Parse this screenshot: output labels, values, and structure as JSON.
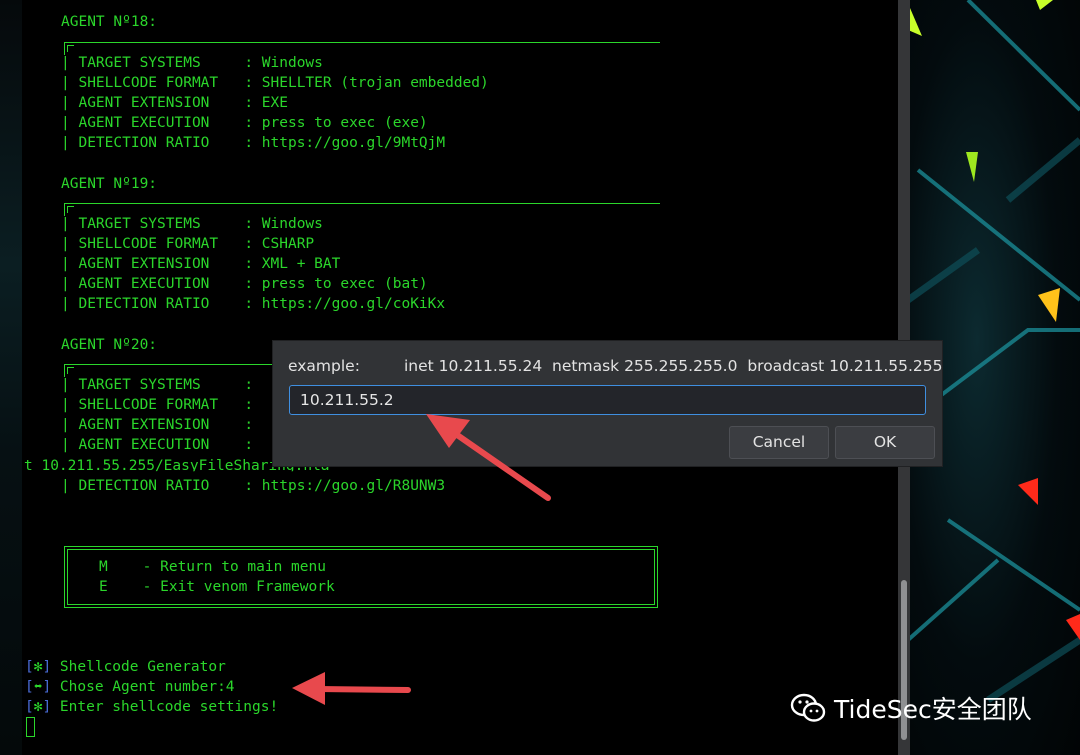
{
  "terminal": {
    "agent18": {
      "header": "AGENT Nº18:",
      "rows": [
        "| TARGET SYSTEMS     : Windows",
        "| SHELLCODE FORMAT   : SHELLTER (trojan embedded)",
        "| AGENT EXTENSION    : EXE",
        "| AGENT EXECUTION    : press to exec (exe)",
        "| DETECTION RATIO    : https://goo.gl/9MtQjM"
      ]
    },
    "agent19": {
      "header": "AGENT Nº19:",
      "rows": [
        "| TARGET SYSTEMS     : Windows",
        "| SHELLCODE FORMAT   : CSHARP",
        "| AGENT EXTENSION    : XML + BAT",
        "| AGENT EXECUTION    : press to exec (bat)",
        "| DETECTION RATIO    : https://goo.gl/coKiKx"
      ]
    },
    "agent20": {
      "header": "AGENT Nº20:",
      "rows": [
        "| TARGET SYSTEMS     :",
        "| SHELLCODE FORMAT   :",
        "| AGENT EXTENSION    :",
        "| AGENT EXECUTION    :"
      ],
      "overflow_line": "t 10.211.55.255/EasyFileSharing.hta",
      "detection_row": "| DETECTION RATIO    : https://goo.gl/R8UNW3"
    },
    "menu": {
      "line1": "M    - Return to main menu",
      "line2": "E    - Exit venom Framework"
    },
    "status": [
      {
        "open": "[",
        "icon": "✻",
        "close": "]",
        "text": " Shellcode Generator"
      },
      {
        "open": "[",
        "icon": "⬌",
        "close": "]",
        "text": " Chose Agent number:4"
      },
      {
        "open": "[",
        "icon": "✻",
        "close": "]",
        "text": " Enter shellcode settings!"
      }
    ]
  },
  "dialog": {
    "label": "example:",
    "message": "inet 10.211.55.24  netmask 255.255.255.0  broadcast 10.211.55.255",
    "input_value": "10.211.55.2",
    "cancel_label": "Cancel",
    "ok_label": "OK"
  },
  "watermark": {
    "text": "TideSec安全团队",
    "icon": "wechat-icon"
  },
  "colors": {
    "terminal_green": "#2bd62b",
    "bracket_blue": "#4a6cd8",
    "dialog_bg": "#313336",
    "input_focus": "#3f8fe0",
    "arrow_red": "#e8494d"
  }
}
